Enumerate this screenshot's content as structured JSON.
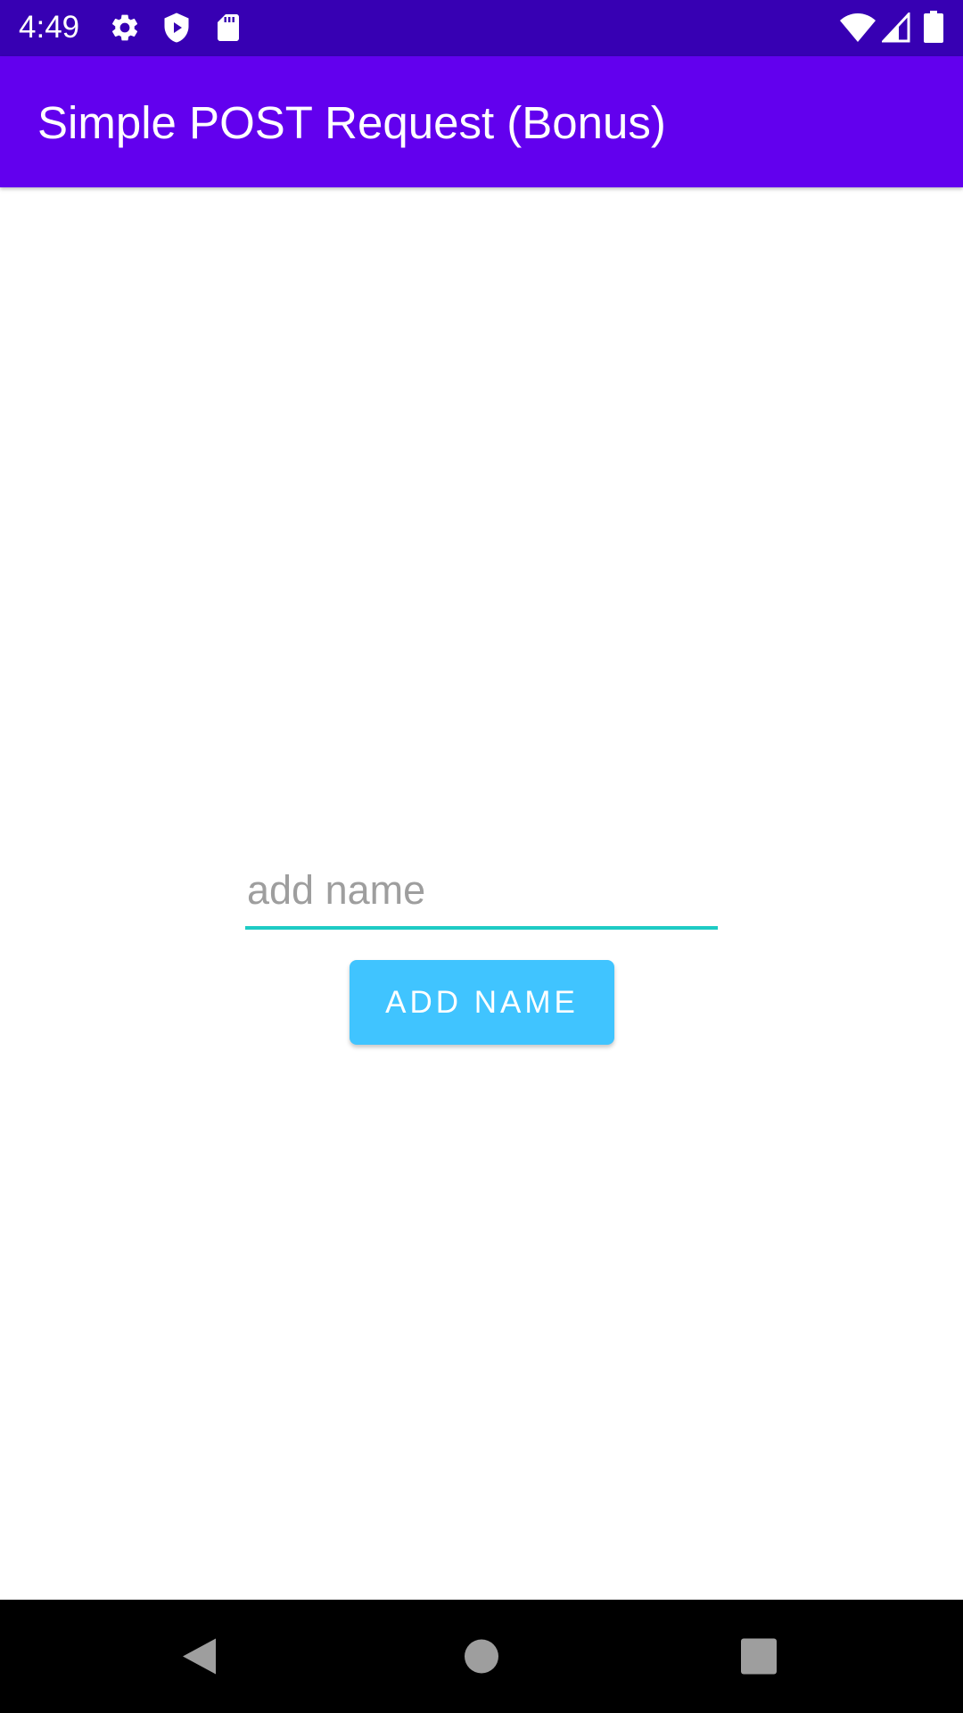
{
  "status_bar": {
    "time": "4:49",
    "background_color": "#3700B3",
    "left_icons": [
      "gear-icon",
      "shield-icon",
      "sd-card-icon"
    ],
    "right_icons": [
      "wifi-icon",
      "signal-icon",
      "battery-icon"
    ]
  },
  "app_bar": {
    "title": "Simple POST Request (Bonus)",
    "background_color": "#6200EE"
  },
  "form": {
    "name_input": {
      "placeholder": "add name",
      "value": "",
      "underline_color": "#1ECBC4"
    },
    "add_button": {
      "label": "ADD NAME",
      "background_color": "#40C4FF"
    }
  },
  "nav_bar": {
    "buttons": [
      "back-icon",
      "home-icon",
      "recents-icon"
    ]
  }
}
